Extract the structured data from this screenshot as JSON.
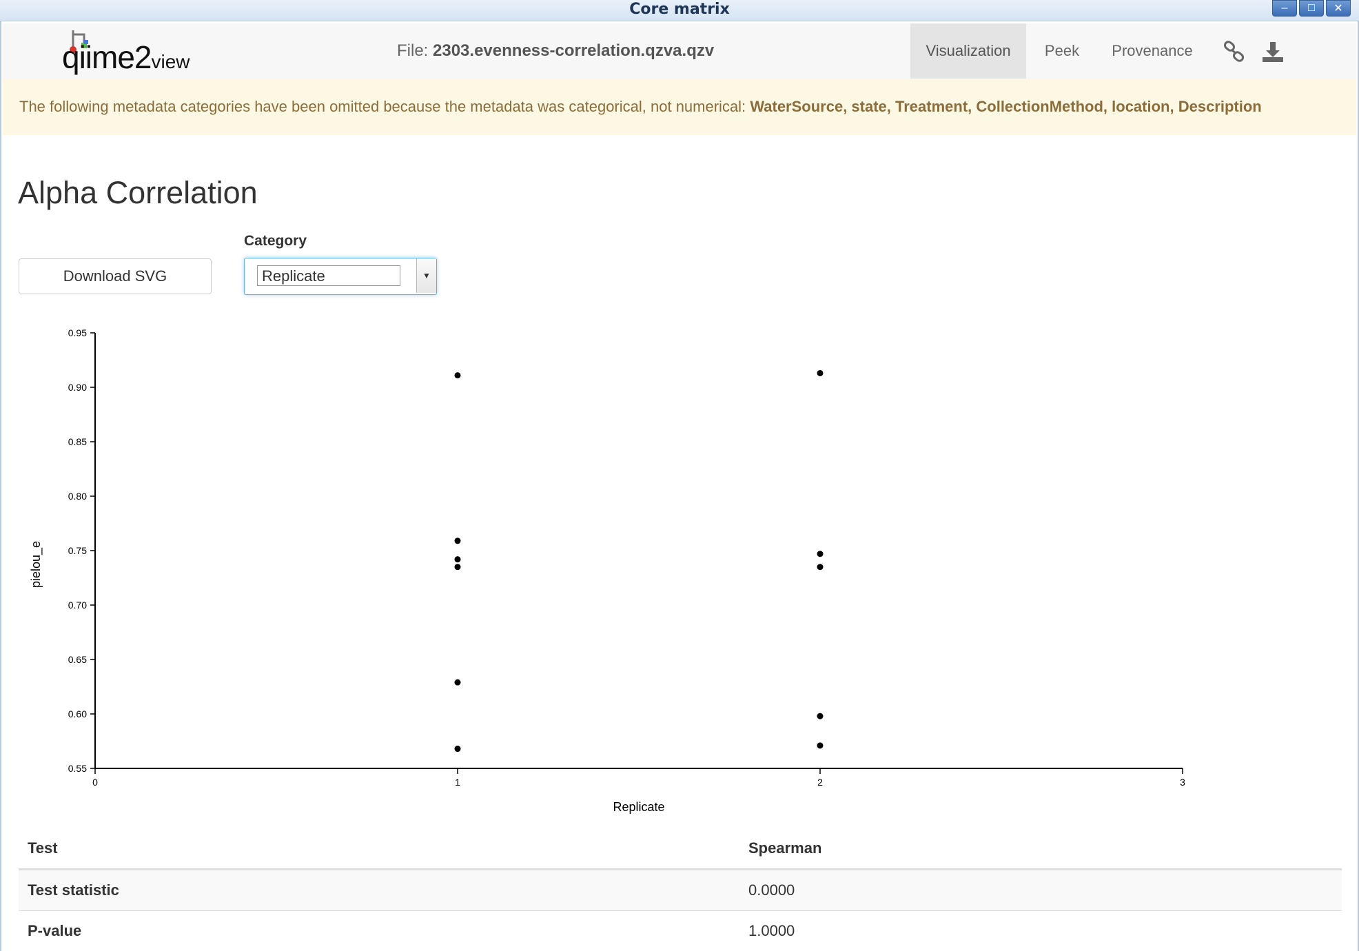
{
  "window": {
    "title": "Core matrix",
    "controls": [
      "–",
      "□",
      "✕"
    ]
  },
  "navbar": {
    "logo_main": "qiime2",
    "logo_sub": "view",
    "file_prefix": "File:",
    "file_name": "2303.evenness-correlation.qzva.qzv",
    "tabs": [
      "Visualization",
      "Peek",
      "Provenance"
    ],
    "active_tab": "Visualization",
    "icons": [
      "link-icon",
      "download-icon"
    ]
  },
  "alert": {
    "prefix": "The following metadata categories have been omitted because the metadata was categorical, not numerical:",
    "categories": "WaterSource, state, Treatment, CollectionMethod, location, Description"
  },
  "page": {
    "title": "Alpha Correlation",
    "download_button": "Download SVG",
    "category_label": "Category",
    "category_value": "Replicate"
  },
  "chart_data": {
    "type": "scatter",
    "xlabel": "Replicate",
    "ylabel": "pielou_e",
    "xlim": [
      0,
      3
    ],
    "ylim": [
      0.55,
      0.95
    ],
    "xticks": [
      "0",
      "1",
      "2",
      "3"
    ],
    "yticks": [
      "0.55",
      "0.60",
      "0.65",
      "0.70",
      "0.75",
      "0.80",
      "0.85",
      "0.90",
      "0.95"
    ],
    "points": [
      {
        "x": 1,
        "y": 0.911
      },
      {
        "x": 1,
        "y": 0.759
      },
      {
        "x": 1,
        "y": 0.742
      },
      {
        "x": 1,
        "y": 0.735
      },
      {
        "x": 1,
        "y": 0.629
      },
      {
        "x": 1,
        "y": 0.568
      },
      {
        "x": 2,
        "y": 0.913
      },
      {
        "x": 2,
        "y": 0.747
      },
      {
        "x": 2,
        "y": 0.735
      },
      {
        "x": 2,
        "y": 0.598
      },
      {
        "x": 2,
        "y": 0.571
      }
    ]
  },
  "stats": {
    "headers": [
      "Test",
      "Spearman"
    ],
    "rows": [
      {
        "label": "Test statistic",
        "value": "0.0000"
      },
      {
        "label": "P-value",
        "value": "1.0000"
      }
    ]
  }
}
